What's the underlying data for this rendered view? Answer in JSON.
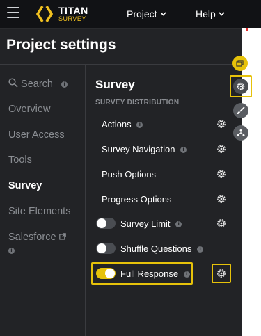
{
  "header": {
    "brand_title": "TITAN",
    "brand_sub": "SURVEY",
    "nav": [
      {
        "label": "Project"
      },
      {
        "label": "Help"
      }
    ]
  },
  "page": {
    "title": "Project settings"
  },
  "sidebar": {
    "items": [
      {
        "label": "Search"
      },
      {
        "label": "Overview"
      },
      {
        "label": "User Access"
      },
      {
        "label": "Tools"
      },
      {
        "label": "Survey",
        "active": true
      },
      {
        "label": "Site Elements"
      },
      {
        "label": "Salesforce"
      }
    ]
  },
  "main": {
    "title": "Survey",
    "subtitle": "SURVEY DISTRIBUTION",
    "rows": [
      {
        "label": "Actions",
        "has_info": true,
        "has_gear": true
      },
      {
        "label": "Survey Navigation",
        "has_info": true,
        "has_gear": true
      },
      {
        "label": "Push Options",
        "has_gear": true
      },
      {
        "label": "Progress Options",
        "has_gear": true
      },
      {
        "label": "Survey Limit",
        "has_info": true,
        "has_gear": true,
        "toggle": false
      },
      {
        "label": "Shuffle Questions",
        "has_info": true,
        "toggle": false
      },
      {
        "label": "Full Response",
        "has_info": true,
        "has_gear": true,
        "toggle": true
      }
    ]
  },
  "colors": {
    "accent": "#e6c20a",
    "background": "#222326",
    "topbar": "#111215"
  },
  "icons": [
    "menu-icon",
    "titan-logo-icon",
    "chevron-down-icon",
    "search-icon",
    "info-icon",
    "external-link-icon",
    "gear-icon",
    "layers-icon",
    "brush-icon",
    "hierarchy-icon"
  ]
}
